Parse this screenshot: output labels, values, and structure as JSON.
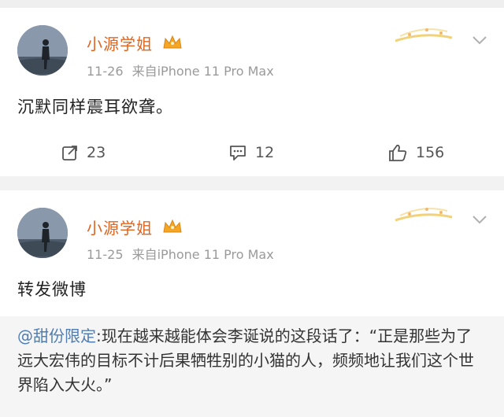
{
  "posts": [
    {
      "user_name": "小源学姐",
      "date": "11-26",
      "source": "来自iPhone 11 Pro Max",
      "text": "沉默同样震耳欲聋。",
      "actions": {
        "repost": "23",
        "comment": "12",
        "like": "156"
      }
    },
    {
      "user_name": "小源学姐",
      "date": "11-25",
      "source": "来自iPhone 11 Pro Max",
      "text": "转发微博",
      "repost": {
        "mention": "@甜份限定",
        "text": ":现在越来越能体会李诞说的这段话了：“正是那些为了远大宏伟的目标不计后果牺牲别的小猫的人，频频地让我们这个世界陷入大火。”"
      }
    }
  ],
  "icons": {
    "crown": "crown-icon",
    "repost": "repost-icon",
    "comment": "comment-icon",
    "like": "thumbs-up-icon",
    "chevron": "chevron-down-icon"
  },
  "colors": {
    "name": "#e0641f",
    "mention": "#4f7db3",
    "meta": "#9a9a9a",
    "background": "#f2f2f2"
  }
}
